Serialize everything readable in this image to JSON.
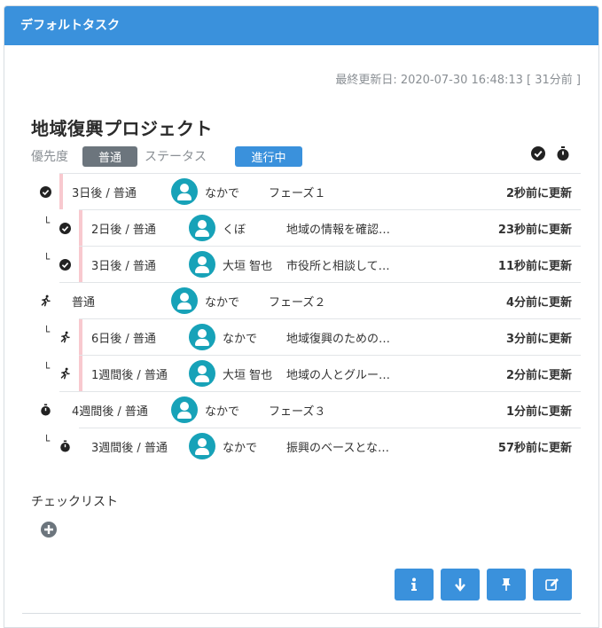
{
  "header": {
    "title": "デフォルトタスク"
  },
  "last_updated": "最終更新日: 2020-07-30 16:48:13 [ 31分前 ]",
  "project": {
    "title": "地域復興プロジェクト",
    "priority_label": "優先度",
    "priority_value": "普通",
    "status_label": "ステータス",
    "status_value": "進行中"
  },
  "tasks": [
    {
      "level": 0,
      "icon": "check-circle-icon",
      "deadline": "3日後 / 普通",
      "user": "なかで",
      "name": "フェーズ１",
      "updated": "2秒前に更新",
      "bar": true
    },
    {
      "level": 1,
      "icon": "check-circle-icon",
      "deadline": "2日後 / 普通",
      "user": "くぼ",
      "name": "地域の情報を確認…",
      "updated": "23秒前に更新",
      "bar": true
    },
    {
      "level": 1,
      "icon": "check-circle-icon",
      "deadline": "3日後 / 普通",
      "user": "大垣 智也",
      "name": "市役所と相談して…",
      "updated": "11秒前に更新",
      "bar": true
    },
    {
      "level": 0,
      "icon": "running-icon",
      "deadline": "普通",
      "user": "なかで",
      "name": "フェーズ２",
      "updated": "4分前に更新",
      "bar": false
    },
    {
      "level": 1,
      "icon": "running-icon",
      "deadline": "6日後 / 普通",
      "user": "なかで",
      "name": "地域復興のための…",
      "updated": "3分前に更新",
      "bar": true
    },
    {
      "level": 1,
      "icon": "running-icon",
      "deadline": "1週間後 / 普通",
      "user": "大垣 智也",
      "name": "地域の人とグルー…",
      "updated": "2分前に更新",
      "bar": true
    },
    {
      "level": 0,
      "icon": "stopwatch-icon",
      "deadline": "4週間後 / 普通",
      "user": "なかで",
      "name": "フェーズ３",
      "updated": "1分前に更新",
      "bar": false
    },
    {
      "level": 1,
      "icon": "stopwatch-icon",
      "deadline": "3週間後 / 普通",
      "user": "なかで",
      "name": "振興のベースとな…",
      "updated": "57秒前に更新",
      "bar": false
    }
  ],
  "child_marker": "└",
  "checklist": {
    "title": "チェックリスト"
  }
}
